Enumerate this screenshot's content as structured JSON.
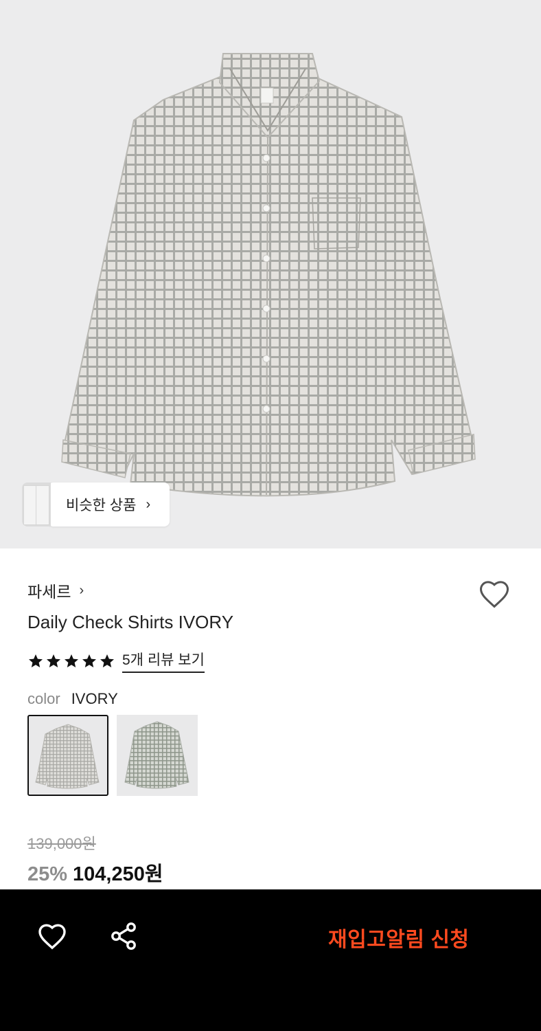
{
  "product_image": {
    "similar_products_label": "비슷한 상품",
    "chevron_icon": "chevron-right-icon"
  },
  "product": {
    "brand": "파세르",
    "title": "Daily Check Shirts IVORY",
    "rating_stars": 5,
    "reviews_label": "5개 리뷰 보기",
    "color_label": "color",
    "color_value": "IVORY",
    "original_price": "139,000원",
    "discount": "25%",
    "price": "104,250원"
  },
  "actions": {
    "restock_label": "재입고알림 신청",
    "wishlist_icon": "heart-outline-icon",
    "share_icon": "share-icon"
  },
  "colors": {
    "accent": "#ff4a1f",
    "bottom_bar": "#000000",
    "image_bg": "#ececed"
  }
}
